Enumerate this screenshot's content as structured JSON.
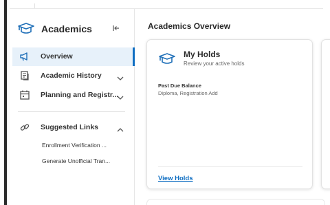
{
  "sidebar": {
    "title": "Academics",
    "collapse_icon": "collapse-left-icon",
    "nav": [
      {
        "label": "Overview",
        "icon": "megaphone-icon",
        "active": true
      },
      {
        "label": "Academic History",
        "icon": "document-stack-icon",
        "expandable": true
      },
      {
        "label": "Planning and Registr...",
        "icon": "calendar-icon",
        "expandable": true
      }
    ],
    "suggested": {
      "label": "Suggested Links",
      "icon": "link-icon",
      "expanded": true,
      "links": [
        "Enrollment Verification ...",
        "Generate Unofficial Tran..."
      ]
    }
  },
  "main": {
    "title": "Academics Overview",
    "holds_card": {
      "title": "My Holds",
      "subtitle": "Review your active holds",
      "hold_title": "Past Due Balance",
      "hold_desc": "Diploma, Registration Add",
      "action": "View Holds"
    }
  },
  "colors": {
    "accent": "#0f6ec2",
    "active_bg": "#e7f1fa",
    "text": "#333333"
  }
}
